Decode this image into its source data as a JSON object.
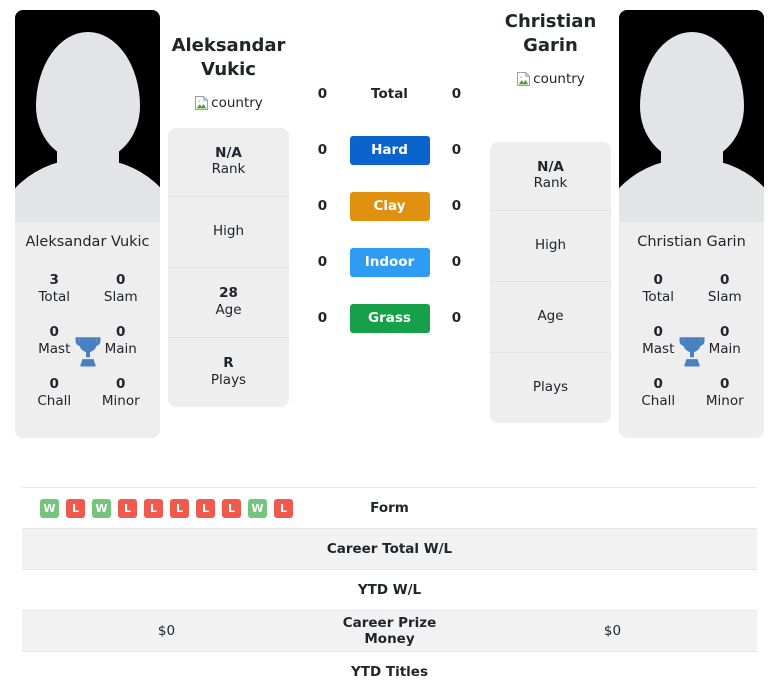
{
  "players": {
    "left": {
      "name_line1": "Aleksandar",
      "name_line2": "Vukic",
      "full_name": "Aleksandar Vukic",
      "flag_alt": "country",
      "info": [
        {
          "value": "N/A",
          "label": "Rank"
        },
        {
          "value": "",
          "label": "High"
        },
        {
          "value": "28",
          "label": "Age"
        },
        {
          "value": "R",
          "label": "Plays"
        }
      ],
      "titles": [
        {
          "value": "3",
          "label": "Total"
        },
        {
          "value": "0",
          "label": "Slam"
        },
        {
          "value": "0",
          "label": "Mast"
        },
        {
          "value": "0",
          "label": "Main"
        },
        {
          "value": "0",
          "label": "Chall"
        },
        {
          "value": "0",
          "label": "Minor"
        }
      ]
    },
    "right": {
      "name_line1": "Christian",
      "name_line2": "Garin",
      "full_name": "Christian Garin",
      "flag_alt": "country",
      "info": [
        {
          "value": "N/A",
          "label": "Rank"
        },
        {
          "value": "",
          "label": "High"
        },
        {
          "value": "",
          "label": "Age"
        },
        {
          "value": "",
          "label": "Plays"
        }
      ],
      "titles": [
        {
          "value": "0",
          "label": "Total"
        },
        {
          "value": "0",
          "label": "Slam"
        },
        {
          "value": "0",
          "label": "Mast"
        },
        {
          "value": "0",
          "label": "Main"
        },
        {
          "value": "0",
          "label": "Chall"
        },
        {
          "value": "0",
          "label": "Minor"
        }
      ]
    }
  },
  "surfaces": [
    {
      "label": "Total",
      "left": "0",
      "right": "0",
      "color": ""
    },
    {
      "label": "Hard",
      "left": "0",
      "right": "0",
      "color": "#0b63ce"
    },
    {
      "label": "Clay",
      "left": "0",
      "right": "0",
      "color": "#e09110"
    },
    {
      "label": "Indoor",
      "left": "0",
      "right": "0",
      "color": "#2f9cf4"
    },
    {
      "label": "Grass",
      "left": "0",
      "right": "0",
      "color": "#17a04a"
    }
  ],
  "form": {
    "left": [
      "W",
      "L",
      "W",
      "L",
      "L",
      "L",
      "L",
      "L",
      "W",
      "L"
    ],
    "right": [],
    "win_color": "#74c47c",
    "loss_color": "#ef5a4c"
  },
  "comparison_rows": [
    {
      "label": "Form",
      "left": "",
      "right": "",
      "striped": false,
      "is_form": true
    },
    {
      "label": "Career Total W/L",
      "left": "",
      "right": "",
      "striped": true,
      "is_form": false
    },
    {
      "label": "YTD W/L",
      "left": "",
      "right": "",
      "striped": false,
      "is_form": false
    },
    {
      "label": "Career Prize Money",
      "left": "$0",
      "right": "$0",
      "striped": true,
      "is_form": false
    },
    {
      "label": "YTD Titles",
      "left": "",
      "right": "",
      "striped": false,
      "is_form": false
    }
  ],
  "icons": {
    "trophy": "trophy-icon",
    "broken_image": "broken-image-icon"
  },
  "colors": {
    "card_bg": "#eeeeee",
    "stripe": "#f2f2f2",
    "trophy": "#4a7fc1",
    "text": "#212529"
  }
}
